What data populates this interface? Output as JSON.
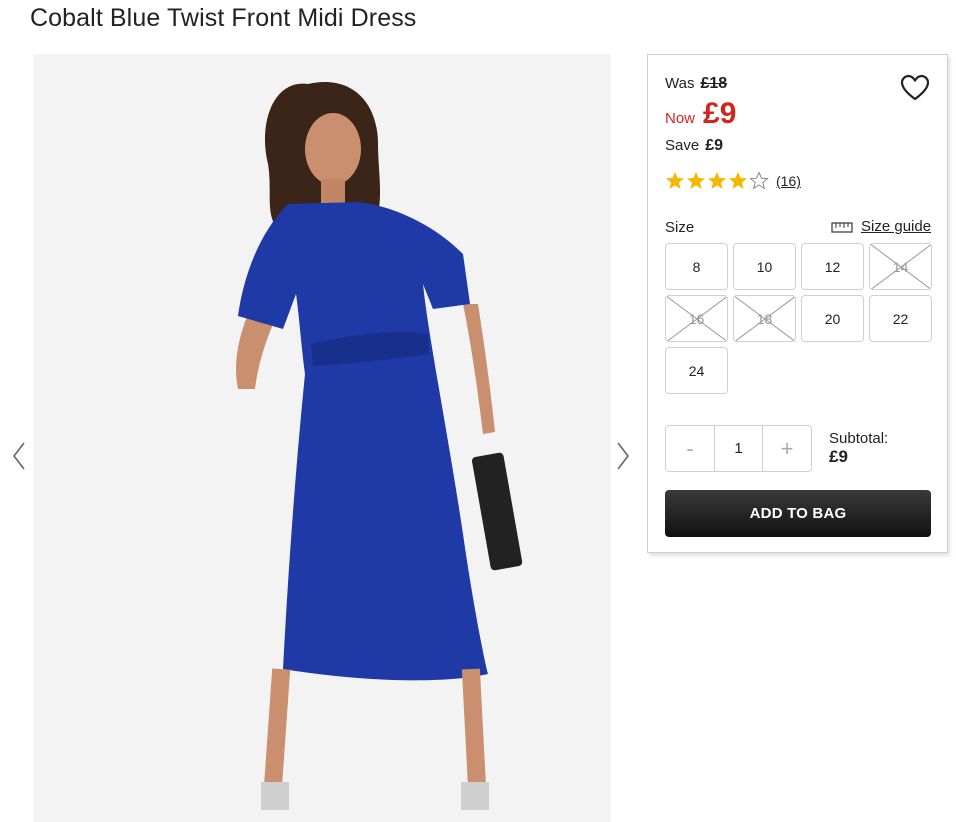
{
  "product": {
    "title": "Cobalt Blue Twist Front Midi Dress"
  },
  "pricing": {
    "was_label": "Was",
    "was_price": "£18",
    "now_label": "Now",
    "now_price": "£9",
    "save_label": "Save",
    "save_price": "£9",
    "now_color": "#d0261f"
  },
  "rating": {
    "stars": 4,
    "max_stars": 5,
    "review_count": "(16)",
    "star_color": "#f5b800"
  },
  "sizes": {
    "label": "Size",
    "guide_label": "Size guide",
    "options": [
      {
        "label": "8",
        "available": true
      },
      {
        "label": "10",
        "available": true
      },
      {
        "label": "12",
        "available": true
      },
      {
        "label": "14",
        "available": false
      },
      {
        "label": "16",
        "available": false
      },
      {
        "label": "18",
        "available": false
      },
      {
        "label": "20",
        "available": true
      },
      {
        "label": "22",
        "available": true
      },
      {
        "label": "24",
        "available": true
      }
    ]
  },
  "quantity": {
    "minus": "-",
    "value": "1",
    "plus": "+"
  },
  "subtotal": {
    "label": "Subtotal:",
    "value": "£9"
  },
  "cta": {
    "add_to_bag": "ADD TO BAG",
    "button_color": "#1a1a1a"
  },
  "icons": {
    "wishlist": "heart-icon",
    "prev": "chevron-left-icon",
    "next": "chevron-right-icon",
    "size_guide": "ruler-icon"
  },
  "dress_color": "#1f3aa6"
}
